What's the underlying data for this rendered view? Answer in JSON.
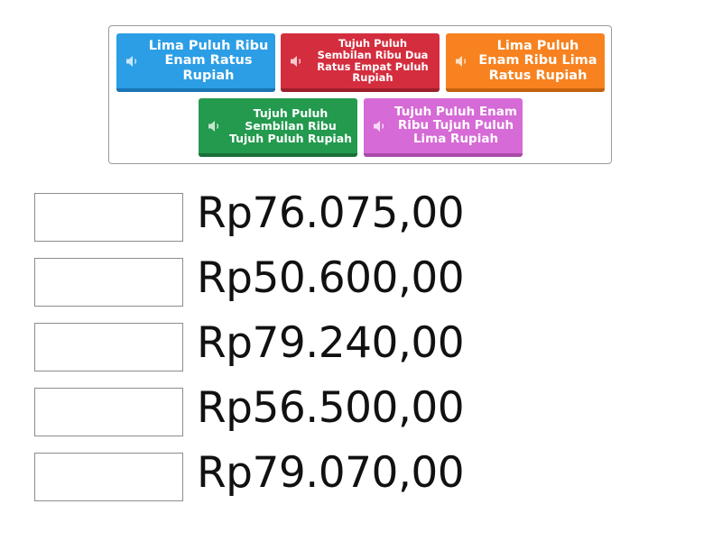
{
  "tiles": [
    {
      "label": "Lima Puluh Ribu Enam Ratus Rupiah",
      "color": "#2c9ee5",
      "icon": "speaker-icon"
    },
    {
      "label": "Tujuh Puluh Sembilan Ribu Dua Ratus Empat Puluh Rupiah",
      "color": "#d42d3e",
      "icon": "speaker-icon"
    },
    {
      "label": "Lima Puluh Enam Ribu Lima Ratus Rupiah",
      "color": "#f7821f",
      "icon": "speaker-icon"
    },
    {
      "label": "Tujuh Puluh Sembilan Ribu Tujuh Puluh Rupiah",
      "color": "#239a4e",
      "icon": "speaker-icon"
    },
    {
      "label": "Tujuh Puluh Enam Ribu Tujuh Puluh Lima Rupiah",
      "color": "#d66ad6",
      "icon": "speaker-icon"
    }
  ],
  "targets": [
    {
      "amount": "Rp76.075,00"
    },
    {
      "amount": "Rp50.600,00"
    },
    {
      "amount": "Rp79.240,00"
    },
    {
      "amount": "Rp56.500,00"
    },
    {
      "amount": "Rp79.070,00"
    }
  ]
}
